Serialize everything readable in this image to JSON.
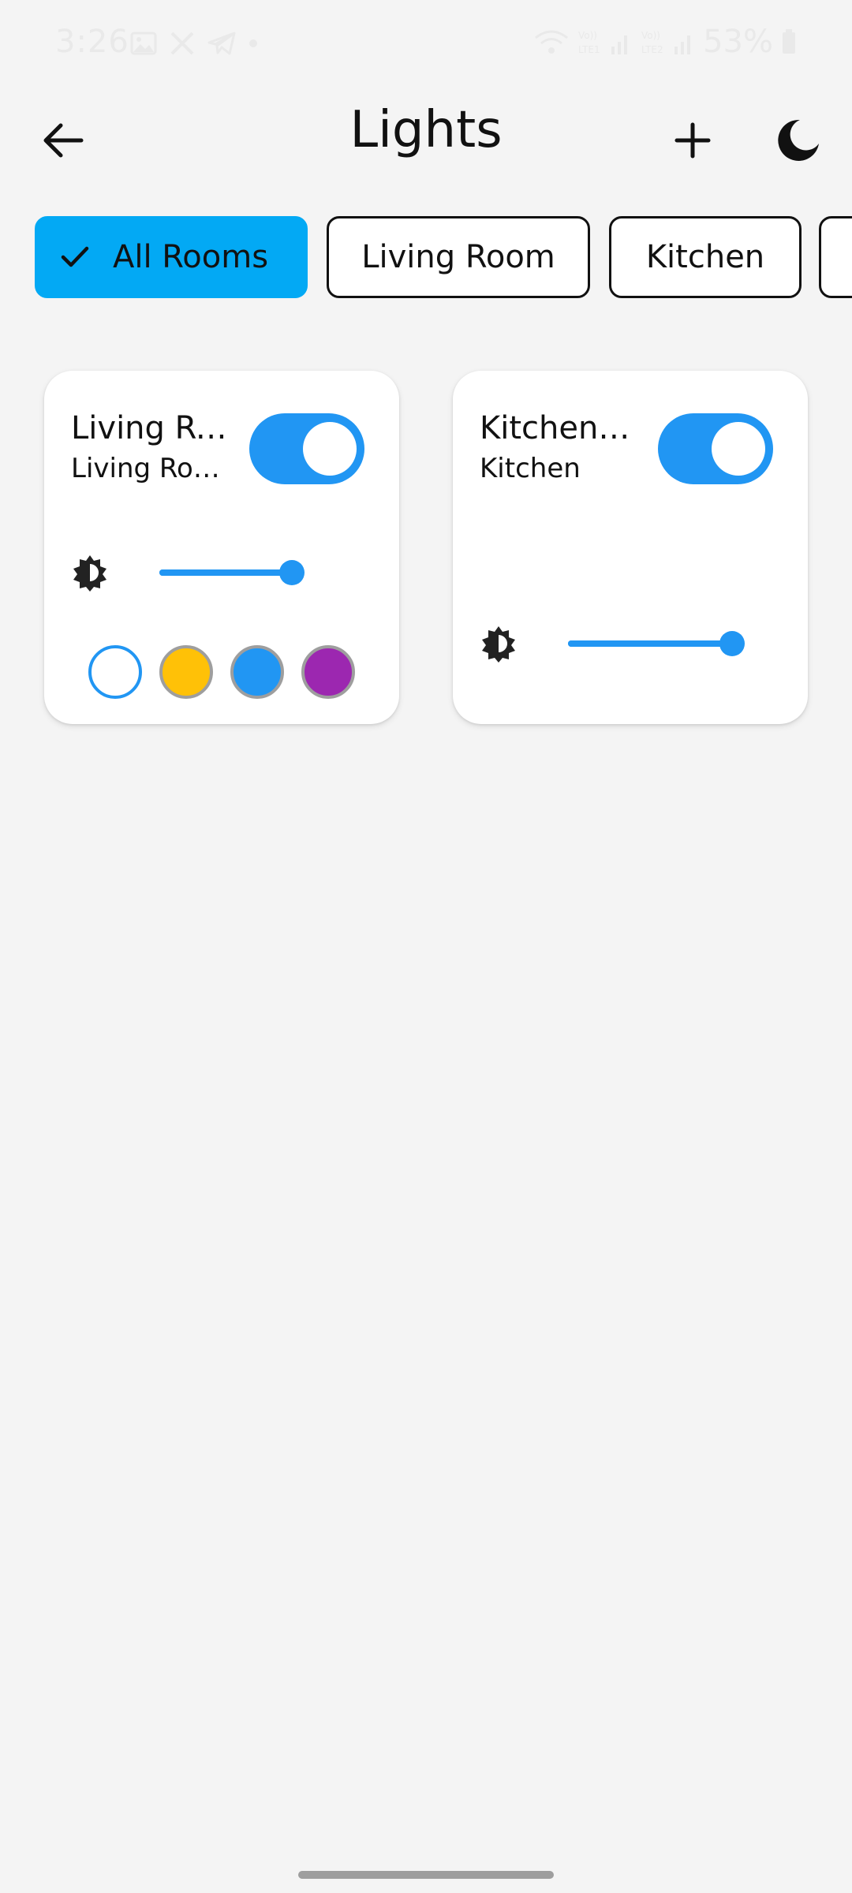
{
  "status_bar": {
    "time": "3:26",
    "battery": "53%",
    "left_icons": [
      "gallery-icon",
      "x-icon",
      "telegram-icon",
      "dot-icon"
    ],
    "right_icons": [
      "wifi-icon",
      "signal-lte1-icon",
      "signal-lte2-icon",
      "battery-icon"
    ]
  },
  "app_bar": {
    "title": "Lights",
    "back_icon": "arrow-left-icon",
    "add_icon": "plus-icon",
    "theme_icon": "moon-icon"
  },
  "filters": {
    "chips": [
      {
        "label": "All Rooms",
        "selected": true
      },
      {
        "label": "Living Room",
        "selected": false
      },
      {
        "label": "Kitchen",
        "selected": false
      },
      {
        "label": "",
        "selected": false
      }
    ]
  },
  "lights": [
    {
      "name": "Living Ro…",
      "room": "Living Roo…",
      "on": true,
      "brightness": 1.0,
      "colors": [
        {
          "name": "white",
          "hex": "#ffffff",
          "selected": true
        },
        {
          "name": "amber",
          "hex": "#ffc107",
          "selected": false
        },
        {
          "name": "blue",
          "hex": "#2196f3",
          "selected": false
        },
        {
          "name": "purple",
          "hex": "#9c27b0",
          "selected": false
        }
      ]
    },
    {
      "name": "Kitchen C…",
      "room": "Kitchen",
      "on": true,
      "brightness": 1.0,
      "colors": []
    }
  ],
  "theme": {
    "accent": "#2196f3",
    "chip_selected": "#03a9f4",
    "background": "#f4f4f4"
  }
}
